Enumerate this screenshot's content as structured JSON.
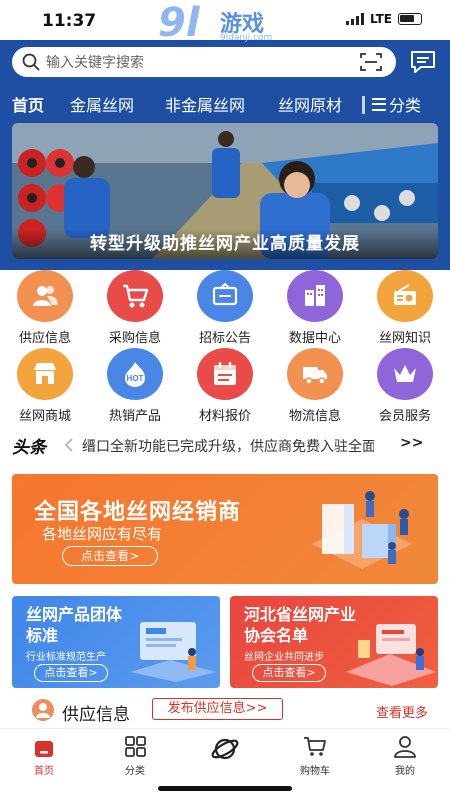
{
  "status_bar": {
    "time": "11:37",
    "network": "LTE"
  },
  "watermark": {
    "number": "9l",
    "text": "游戏",
    "url": "9ldanji.com"
  },
  "search": {
    "placeholder": "输入关键字搜索"
  },
  "nav": {
    "tabs": [
      {
        "label": "首页",
        "active": true
      },
      {
        "label": "金属丝网",
        "active": false
      },
      {
        "label": "非金属丝网",
        "active": false
      },
      {
        "label": "丝网原材",
        "active": false
      }
    ],
    "category_label": "分类"
  },
  "banner": {
    "caption": "转型升级助推丝网产业高质量发展"
  },
  "grid": [
    {
      "label": "供应信息",
      "icon": "users-icon",
      "color": "#f39152"
    },
    {
      "label": "采购信息",
      "icon": "cart-icon",
      "color": "#e84b48"
    },
    {
      "label": "招标公告",
      "icon": "notice-board-icon",
      "color": "#4a86e6"
    },
    {
      "label": "数据中心",
      "icon": "building-icon",
      "color": "#8f66d9"
    },
    {
      "label": "丝网知识",
      "icon": "radio-icon",
      "color": "#f4a43c"
    },
    {
      "label": "丝网商城",
      "icon": "store-icon",
      "color": "#f4a43c"
    },
    {
      "label": "热销产品",
      "icon": "hot-icon",
      "color": "#4a86e6"
    },
    {
      "label": "材料报价",
      "icon": "calendar-icon",
      "color": "#e84b48"
    },
    {
      "label": "物流信息",
      "icon": "truck-icon",
      "color": "#f39152"
    },
    {
      "label": "会员服务",
      "icon": "crown-icon",
      "color": "#8f66d9"
    }
  ],
  "headline": {
    "logo_a": "头条",
    "text": "缙口全新功能已完成升级，供应商免费入驻全面",
    "more": ">>"
  },
  "promo_main": {
    "title": "全国各地丝网经销商",
    "subtitle": "各地丝网应有尽有",
    "button": "点击查看>"
  },
  "promo_left": {
    "title_line1": "丝网产品团体",
    "title_line2": "标准",
    "subtitle": "行业标准规范生产",
    "button": "点击查看>"
  },
  "promo_right": {
    "title_line1": "河北省丝网产业",
    "title_line2": "协会名单",
    "subtitle": "丝网企业共同进步",
    "button": "点击查看>"
  },
  "supply_section": {
    "title": "供应信息",
    "publish_button": "发布供应信息>>",
    "more": "查看更多"
  },
  "bottom_nav": [
    {
      "label": "首页",
      "icon": "home-icon",
      "active": true
    },
    {
      "label": "分类",
      "icon": "grid-icon",
      "active": false
    },
    {
      "label": "",
      "icon": "planet-icon",
      "active": false
    },
    {
      "label": "购物车",
      "icon": "cart-icon",
      "active": false
    },
    {
      "label": "我的",
      "icon": "user-icon",
      "active": false
    }
  ],
  "colors": {
    "brand_blue": "#1f4fa3",
    "accent_red": "#d9322a",
    "promo_orange": "#f6762f"
  }
}
